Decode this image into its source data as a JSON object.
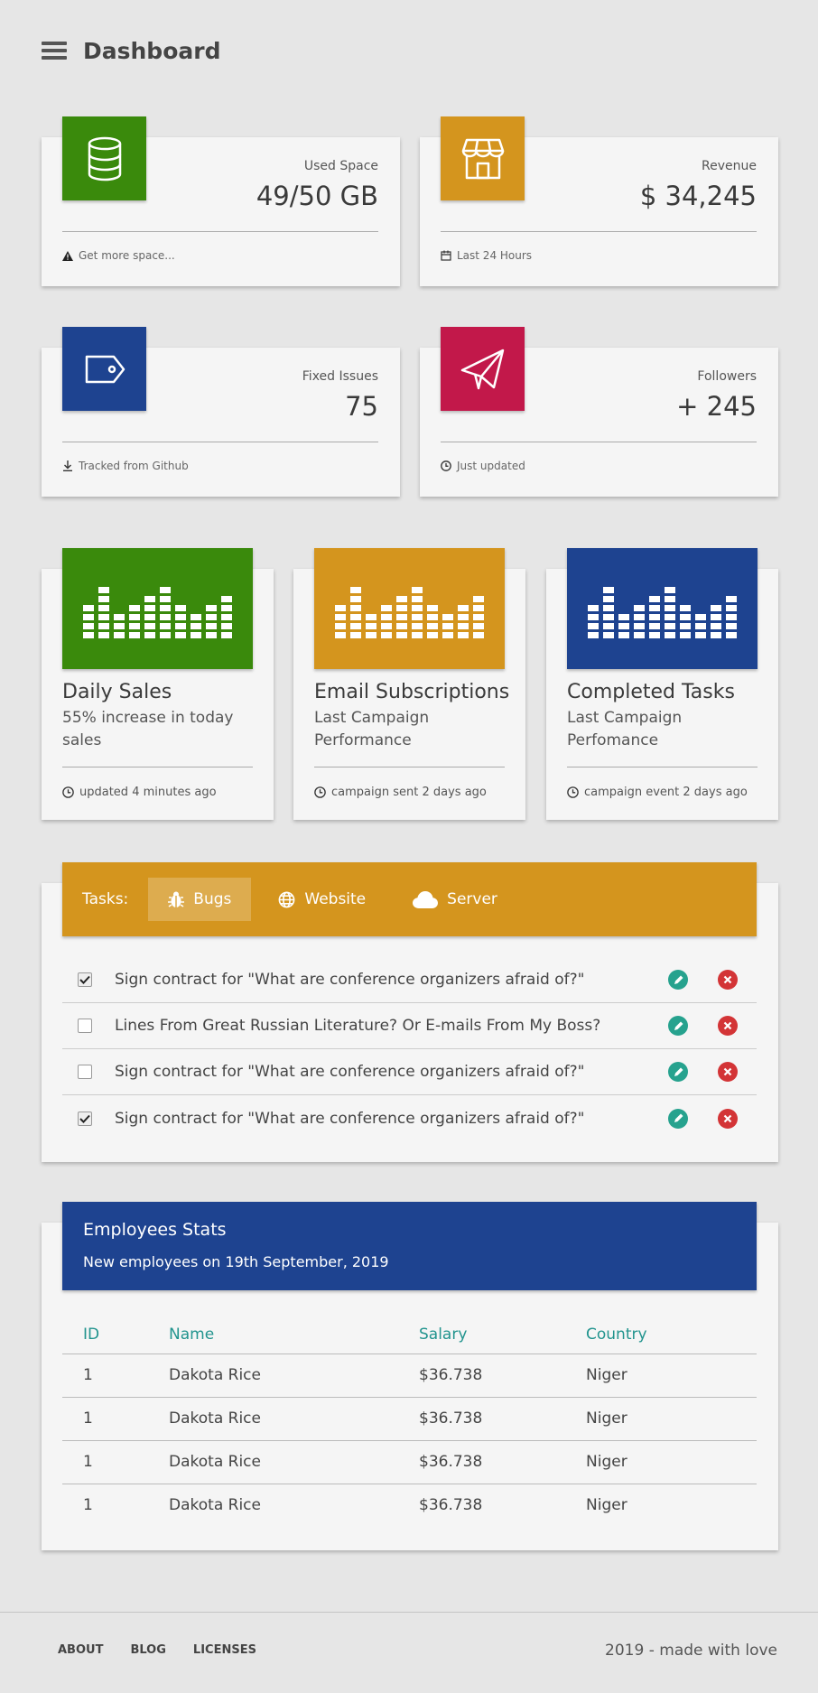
{
  "header": {
    "title": "Dashboard",
    "menu_icon": "hamburger-icon"
  },
  "stats": [
    {
      "label": "Used Space",
      "value": "49/50 GB",
      "footer": "Get more space...",
      "icon": "database-icon",
      "footer_icon": "warning-icon",
      "color": "#3a8a0c"
    },
    {
      "label": "Revenue",
      "value": "$ 34,245",
      "footer": "Last 24 Hours",
      "icon": "store-icon",
      "footer_icon": "calendar-icon",
      "color": "#d4951e"
    },
    {
      "label": "Fixed Issues",
      "value": "75",
      "footer": "Tracked from Github",
      "icon": "tag-icon",
      "footer_icon": "download-icon",
      "color": "#1e4390"
    },
    {
      "label": "Followers",
      "value": "+ 245",
      "footer": "Just updated",
      "icon": "paper-plane-icon",
      "footer_icon": "clock-icon",
      "color": "#c2184a"
    }
  ],
  "charts": [
    {
      "title": "Daily Sales",
      "subtitle": "55% increase in today sales",
      "footer": "updated 4 minutes ago",
      "color": "#3a8a0c"
    },
    {
      "title": "Email Subscriptions",
      "subtitle": "Last Campaign Performance",
      "footer": "campaign sent 2 days ago",
      "color": "#d4951e"
    },
    {
      "title": "Completed Tasks",
      "subtitle": "Last Campaign Perfomance",
      "footer": "campaign event 2 days ago",
      "color": "#1e4390"
    }
  ],
  "tasks": {
    "prefix": "Tasks:",
    "color": "#d4951e",
    "tabs": [
      {
        "label": "Bugs",
        "icon": "bug-icon",
        "active": true
      },
      {
        "label": "Website",
        "icon": "globe-icon",
        "active": false
      },
      {
        "label": "Server",
        "icon": "cloud-icon",
        "active": false
      }
    ],
    "items": [
      {
        "text": "Sign contract for \"What are conference organizers afraid of?\"",
        "checked": true
      },
      {
        "text": "Lines From Great Russian Literature? Or E-mails From My Boss?",
        "checked": false
      },
      {
        "text": "Sign contract for \"What are conference organizers afraid of?\"",
        "checked": false
      },
      {
        "text": "Sign contract for \"What are conference organizers afraid of?\"",
        "checked": true
      }
    ]
  },
  "employees": {
    "title": "Employees Stats",
    "subtitle": "New employees on 19th September, 2019",
    "color": "#1e4390",
    "columns": [
      "ID",
      "Name",
      "Salary",
      "Country"
    ],
    "rows": [
      [
        "1",
        "Dakota Rice",
        "$36.738",
        "Niger"
      ],
      [
        "1",
        "Dakota Rice",
        "$36.738",
        "Niger"
      ],
      [
        "1",
        "Dakota Rice",
        "$36.738",
        "Niger"
      ],
      [
        "1",
        "Dakota Rice",
        "$36.738",
        "Niger"
      ]
    ]
  },
  "footer": {
    "links": [
      "ABOUT",
      "BLOG",
      "LICENSES"
    ],
    "copyright": "2019 - made with love"
  }
}
